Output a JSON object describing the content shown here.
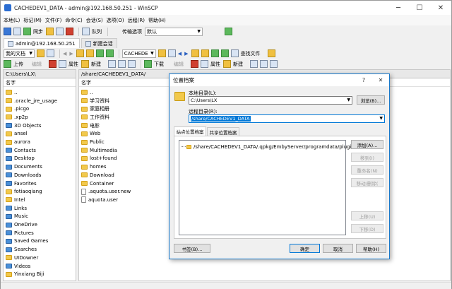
{
  "window": {
    "title": "CACHEDEV1_DATA - admin@192.168.50.251 - WinSCP"
  },
  "menu": [
    "本地(L)",
    "标记(M)",
    "文件(F)",
    "命令(C)",
    "会话(S)",
    "选项(O)",
    "远程(R)",
    "帮助(H)"
  ],
  "toolbar": {
    "sync_label": "同步",
    "queue_label": "队列",
    "transfer_label": "传输选项",
    "transfer_value": "默认"
  },
  "tabs": {
    "session": "admin@192.168.50.251",
    "new_session": "新建会话"
  },
  "left_nav": {
    "drive": "我的文档"
  },
  "left_actions": {
    "upload": "上传",
    "edit": "编辑",
    "properties": "属性",
    "new": "新建"
  },
  "right_nav": {
    "dir": "CACHEDE",
    "find": "查找文件"
  },
  "right_actions": {
    "download": "下载",
    "edit": "编辑",
    "properties": "属性",
    "new": "新建"
  },
  "left_panel": {
    "path": "C:\\Users\\LX\\",
    "column": "名字",
    "items": [
      "..",
      ".oracle_jre_usage",
      ".picgo",
      ".xp2p",
      "3D Objects",
      "ansel",
      "aurora",
      "Contacts",
      "Desktop",
      "Documents",
      "Downloads",
      "Favorites",
      "fotiaoqiang",
      "Intel",
      "Links",
      "Music",
      "OneDrive",
      "Pictures",
      "Saved Games",
      "Searches",
      "UIDowner",
      "Videos",
      "Yinxiang Biji"
    ]
  },
  "right_panel": {
    "path": "/share/CACHEDEV1_DATA/",
    "column": "名字",
    "items": [
      "..",
      "学习资料",
      "家庭相册",
      "工作资料",
      "电影",
      "Web",
      "Public",
      "Multimedia",
      "lost+found",
      "homes",
      "Download",
      "Container",
      ".aquota.user.new",
      "aquota.user"
    ]
  },
  "dialog": {
    "title": "位置档案",
    "help": "?",
    "close": "✕",
    "local_label": "本地目录(L):",
    "local_value": "C:\\Users\\LX",
    "browse": "浏览(B)...",
    "remote_label": "远程目录(R):",
    "remote_value": "/share/CACHEDEV1_DATA",
    "tab_site": "站点位置档案",
    "tab_shared": "共享位置档案",
    "tree_item": "/share/CACHEDEV1_DATA/.qpkg/EmbyServer/programdata/plugins",
    "add": "添加(A)...",
    "move_to": "移到(I)",
    "rename": "重命名(N)",
    "move_del": "移动/删除(",
    "up": "上移(U)",
    "down": "下移(D)",
    "bookmark": "书签(B)...",
    "ok": "确定",
    "cancel": "取消",
    "helpbtn": "帮助(H)"
  }
}
